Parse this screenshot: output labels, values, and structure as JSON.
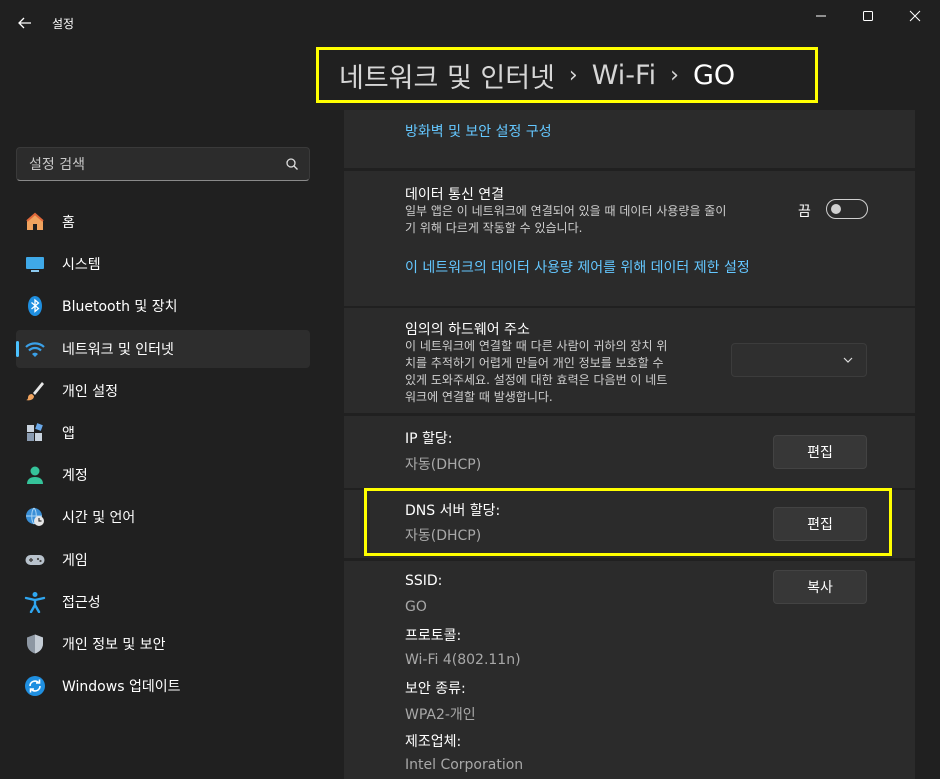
{
  "window": {
    "title": "설정"
  },
  "breadcrumb": [
    "네트워크 및 인터넷",
    "Wi-Fi",
    "GO"
  ],
  "search": {
    "placeholder": "설정 검색"
  },
  "sidebar": {
    "items": [
      {
        "label": "홈",
        "icon": "home-icon"
      },
      {
        "label": "시스템",
        "icon": "monitor-icon"
      },
      {
        "label": "Bluetooth 및 장치",
        "icon": "bluetooth-icon"
      },
      {
        "label": "네트워크 및 인터넷",
        "icon": "wifi-icon",
        "active": true
      },
      {
        "label": "개인 설정",
        "icon": "brush-icon"
      },
      {
        "label": "앱",
        "icon": "apps-icon"
      },
      {
        "label": "계정",
        "icon": "account-icon"
      },
      {
        "label": "시간 및 언어",
        "icon": "globe-clock-icon"
      },
      {
        "label": "게임",
        "icon": "gamepad-icon"
      },
      {
        "label": "접근성",
        "icon": "accessibility-icon"
      },
      {
        "label": "개인 정보 및 보안",
        "icon": "shield-icon"
      },
      {
        "label": "Windows 업데이트",
        "icon": "update-icon"
      }
    ]
  },
  "main": {
    "firewall_link": "방화벽 및 보안 설정 구성",
    "metered": {
      "title": "데이터 통신 연결",
      "desc_line1": "일부 앱은 이 네트워크에 연결되어 있을 때 데이터 사용량을 줄이",
      "desc_line2": "기 위해 다르게 작동할 수 있습니다.",
      "toggle_label": "끔",
      "toggle_on": false,
      "link": "이 네트워크의 데이터 사용량 제어를 위해 데이터 제한 설정"
    },
    "random_hw": {
      "title": "임의의 하드웨어 주소",
      "desc_line1": "이 네트워크에 연결할 때 다른 사람이 귀하의 장치 위",
      "desc_line2": "치를 추적하기 어렵게 만들어 개인 정보를 보호할 수",
      "desc_line3": "있게 도와주세요. 설정에 대한 효력은 다음번 이 네트",
      "desc_line4": "워크에 연결할 때 발생합니다."
    },
    "ip": {
      "title": "IP 할당:",
      "value": "자동(DHCP)",
      "button": "편집"
    },
    "dns": {
      "title": "DNS 서버 할당:",
      "value": "자동(DHCP)",
      "button": "편집"
    },
    "props": {
      "copy_button": "복사",
      "ssid_label": "SSID:",
      "ssid_value": "GO",
      "protocol_label": "프로토콜:",
      "protocol_value": "Wi-Fi 4(802.11n)",
      "security_label": "보안 종류:",
      "security_value": "WPA2-개인",
      "manufacturer_label": "제조업체:",
      "manufacturer_value": "Intel Corporation"
    }
  },
  "colors": {
    "accent": "#4cc2ff",
    "link": "#64c7ff",
    "highlight": "#ffff00",
    "background": "#202020",
    "card": "#2b2b2b"
  }
}
